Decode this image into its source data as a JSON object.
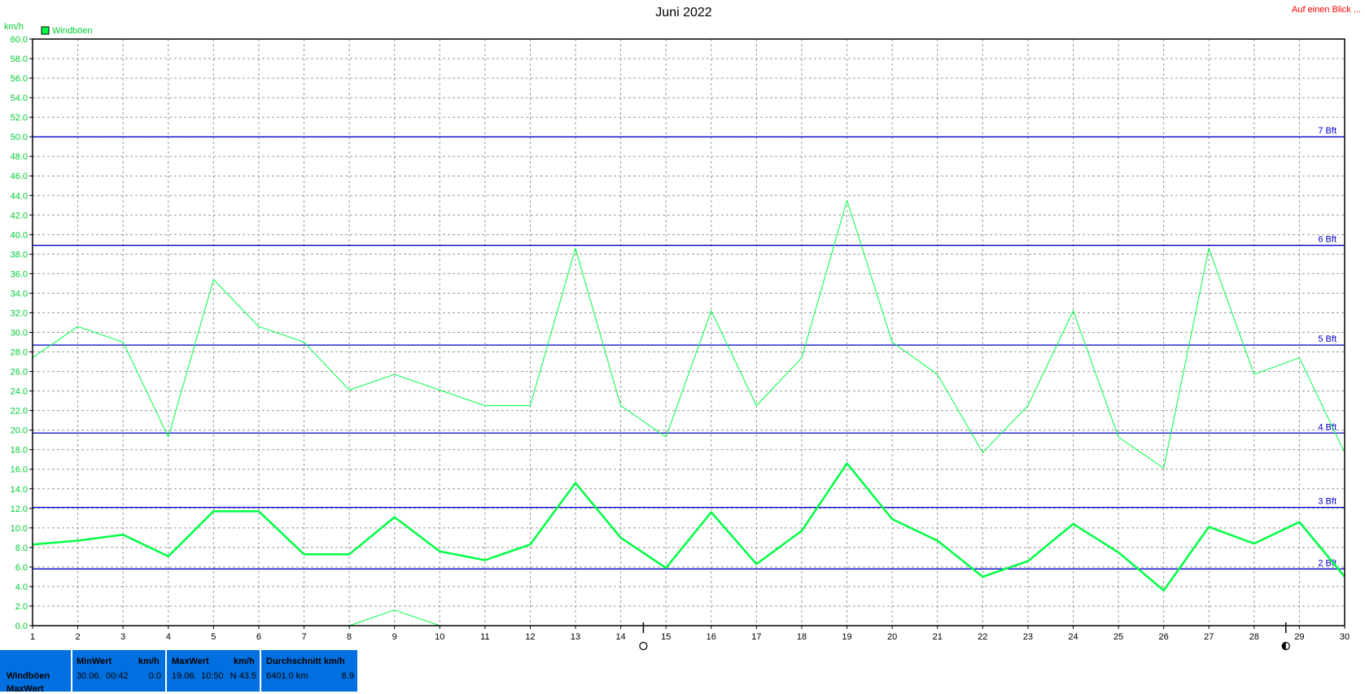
{
  "header": {
    "title": "Juni 2022",
    "link_label": "Auf einen Blick ...",
    "unit_label": "km/h",
    "legend_label": "Windböen"
  },
  "colors": {
    "series": "#00ff44",
    "axis_text": "#00cc33",
    "bft_line": "#0000cc",
    "grid": "#9a9a9a",
    "footer_bg": "#0070e0"
  },
  "chart_data": {
    "type": "line",
    "title": "Juni 2022",
    "ylabel": "km/h",
    "ylim": [
      0,
      60
    ],
    "y_ticks": [
      "0.0",
      "2.0",
      "4.0",
      "6.0",
      "8.0",
      "10.0",
      "12.0",
      "14.0",
      "16.0",
      "18.0",
      "20.0",
      "22.0",
      "24.0",
      "26.0",
      "28.0",
      "30.0",
      "32.0",
      "34.0",
      "36.0",
      "38.0",
      "40.0",
      "42.0",
      "44.0",
      "46.0",
      "48.0",
      "50.0",
      "52.0",
      "54.0",
      "56.0",
      "58.0",
      "60.0"
    ],
    "xlim": [
      1,
      30
    ],
    "x_ticks": [
      "1",
      "2",
      "3",
      "4",
      "5",
      "6",
      "7",
      "8",
      "9",
      "10",
      "11",
      "12",
      "13",
      "14",
      "15",
      "16",
      "17",
      "18",
      "19",
      "20",
      "21",
      "22",
      "23",
      "24",
      "25",
      "26",
      "27",
      "28",
      "29",
      "30"
    ],
    "legend": [
      "Windböen"
    ],
    "grid": true,
    "legend_position": "top-left",
    "series": [
      {
        "name": "Windböen",
        "x": [
          1,
          2,
          3,
          4,
          5,
          6,
          7,
          8,
          9,
          10,
          11,
          12,
          13,
          14,
          15,
          16,
          17,
          18,
          19,
          20,
          21,
          22,
          23,
          24,
          25,
          26,
          27,
          28,
          29,
          30
        ],
        "values": [
          27.4,
          30.6,
          29.0,
          19.3,
          35.4,
          30.6,
          29.0,
          24.1,
          25.7,
          24.1,
          22.5,
          22.5,
          38.6,
          22.5,
          19.3,
          32.2,
          22.5,
          27.4,
          43.5,
          29.0,
          25.7,
          17.7,
          22.5,
          32.2,
          19.3,
          16.1,
          38.6,
          25.7,
          27.4,
          17.7
        ]
      },
      {
        "name": "",
        "x": [
          1,
          2,
          3,
          4,
          5,
          6,
          7,
          8,
          9,
          10,
          11,
          12,
          13,
          14,
          15,
          16,
          17,
          18,
          19,
          20,
          21,
          22,
          23,
          24,
          25,
          26,
          27,
          28,
          29,
          30
        ],
        "values": [
          8.3,
          8.7,
          9.3,
          7.1,
          11.7,
          11.7,
          7.3,
          7.3,
          11.1,
          7.6,
          6.7,
          8.3,
          14.6,
          9.0,
          5.9,
          11.6,
          6.3,
          9.7,
          16.6,
          10.9,
          8.7,
          5.0,
          6.6,
          10.4,
          7.5,
          3.6,
          10.1,
          8.4,
          10.6,
          5.0
        ]
      },
      {
        "name": "",
        "x": [
          8,
          9,
          10
        ],
        "values": [
          0.0,
          1.6,
          0.0
        ]
      }
    ],
    "reference_lines": [
      {
        "label": "2 Bft",
        "value": 5.8
      },
      {
        "label": "3 Bft",
        "value": 12.1
      },
      {
        "label": "4 Bft",
        "value": 19.7
      },
      {
        "label": "5 Bft",
        "value": 28.7
      },
      {
        "label": "6 Bft",
        "value": 38.9
      },
      {
        "label": "7 Bft",
        "value": 50.0
      }
    ],
    "moon_phases": [
      {
        "day": 15,
        "icon": "full-moon-icon"
      },
      {
        "day": 29.2,
        "icon": "last-quarter-moon-icon"
      }
    ]
  },
  "footer": {
    "row_label_1": "Windböen",
    "row_label_2": "MaxWert",
    "min": {
      "header": "MinWert",
      "unit": "km/h",
      "date": "30.06.",
      "time": "00:42",
      "value": "0.0"
    },
    "max": {
      "header": "MaxWert",
      "unit": "km/h",
      "date": "19.06.",
      "time": "10:50",
      "value": "N 43.5"
    },
    "avg": {
      "header": "Durchschnitt km/h",
      "distance": "6401.0 km",
      "value": "8.9"
    }
  }
}
